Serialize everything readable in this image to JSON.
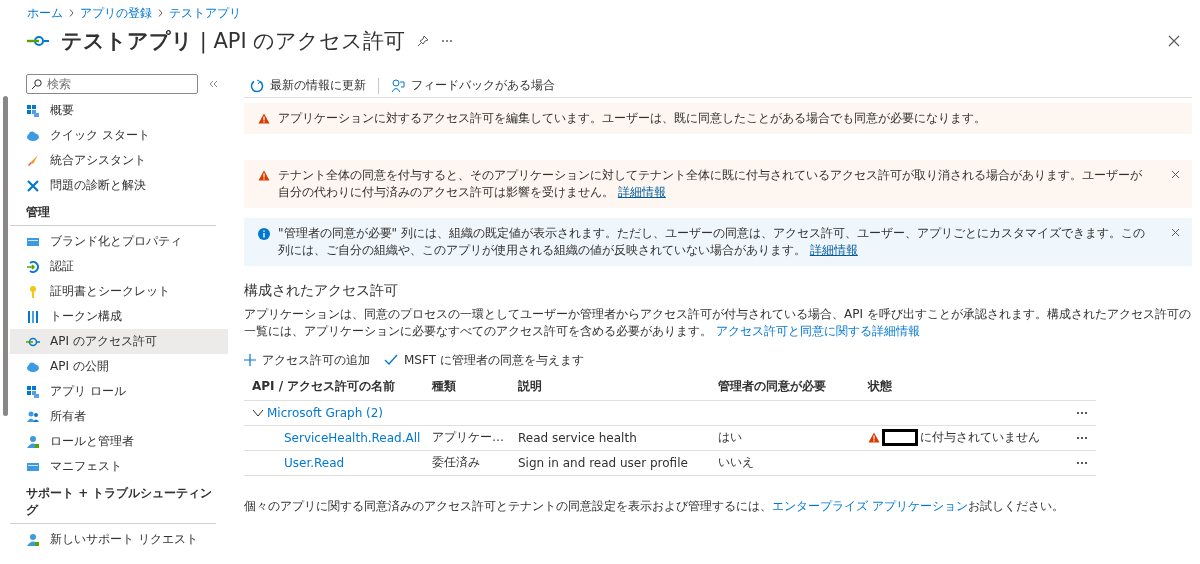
{
  "breadcrumb": [
    "ホーム",
    "アプリの登録",
    "テストアプリ"
  ],
  "title": "**テストアプリ** | API のアクセス許可",
  "sidebar": {
    "search": {
      "placeholder": "検索"
    },
    "sections": [
      {
        "items": [
          {
            "label": "概要",
            "selected": false
          },
          {
            "label": "クイック スタート",
            "selected": false
          },
          {
            "label": "統合アシスタント",
            "selected": false
          },
          {
            "label": "問題の診断と解決",
            "selected": false
          }
        ]
      },
      {
        "heading": "管理",
        "items": [
          {
            "label": "ブランド化とプロパティ",
            "selected": false
          },
          {
            "label": "認証",
            "selected": false
          },
          {
            "label": "証明書とシークレット",
            "selected": false
          },
          {
            "label": "トークン構成",
            "selected": false
          },
          {
            "label": "API のアクセス許可",
            "selected": true
          },
          {
            "label": "API の公開",
            "selected": false
          },
          {
            "label": "アプリ ロール",
            "selected": false
          },
          {
            "label": "所有者",
            "selected": false
          },
          {
            "label": "ロールと管理者",
            "selected": false
          },
          {
            "label": "マニフェスト",
            "selected": false
          }
        ]
      },
      {
        "heading": "サポート + トラブルシューティング",
        "items": [
          {
            "label": "新しいサポート リクエスト",
            "selected": false
          }
        ]
      }
    ]
  },
  "toolbar": [
    "最新の情報に更新",
    "フィードバックがある場合"
  ],
  "banners": [
    {
      "kind": "warning",
      "text": "アプリケーションに対するアクセス許可を編集しています。ユーザーは、既に同意したことがある場合でも同意が必要になります。",
      "dismissible": false
    },
    {
      "kind": "warning",
      "text": "テナント全体の同意を付与すると、そのアプリケーションに対してテナント全体に既に付与されているアクセス許可が取り消される場合があります。ユーザーが自分の代わりに付与済みのアクセス許可は影響を受けません。",
      "link": "詳細情報",
      "dismissible": true
    },
    {
      "kind": "info",
      "text": "\"管理者の同意が必要\" 列には、組織の既定値が表示されます。ただし、ユーザーの同意は、アクセス許可、ユーザー、アプリごとにカスタマイズできます。この列には、ご自分の組織や、このアプリが使用される組織の値が反映されていない場合があります。",
      "link": "詳細情報",
      "dismissible": true
    }
  ],
  "permissions": {
    "heading": "構成されたアクセス許可",
    "description": "アプリケーションは、同意のプロセスの一環としてユーザーか管理者からアクセス許可が付与されている場合、API を呼び出すことが承認されます。構成されたアクセス許可の一覧には、アプリケーションに必要なすべてのアクセス許可を含める必要があります。",
    "link": "アクセス許可と同意に関する詳細情報",
    "actions": [
      "アクセス許可の追加",
      "MSFT に管理者の同意を与えます"
    ],
    "table": {
      "columns": [
        "API / アクセス許可の名前",
        "種類",
        "説明",
        "管理者の同意が必要",
        "状態"
      ],
      "groups": [
        {
          "name": "Microsoft Graph (2)",
          "expanded": true,
          "rows": [
            {
              "name": "ServiceHealth.Read.All",
              "type": "アプリケー…",
              "description": "Read service health",
              "admin_consent": "はい",
              "status": {
                "text": "に付与されていません",
                "warning": true,
                "redacted": true
              }
            },
            {
              "name": "User.Read",
              "type": "委任済み",
              "description": "Sign in and read user profile",
              "admin_consent": "いいえ"
            }
          ]
        }
      ]
    }
  },
  "footer": {
    "text": "個々のアプリに関する同意済みのアクセス許可とテナントの同意設定を表示および管理するには、",
    "link": "エンタープライズ アプリケーション",
    "text_after": "お試しください。"
  }
}
